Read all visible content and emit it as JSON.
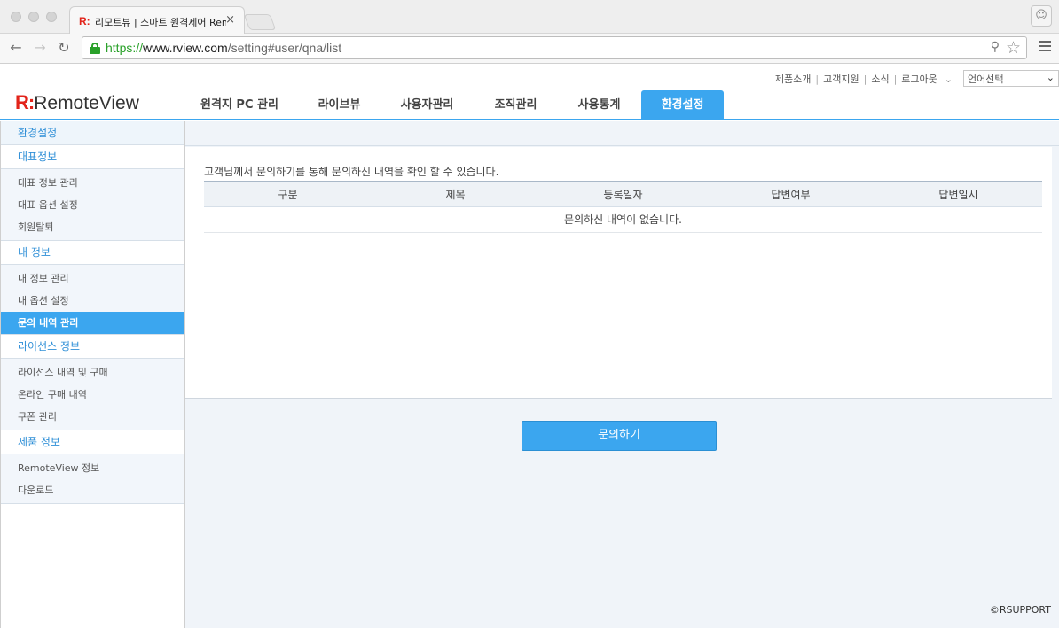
{
  "browser": {
    "tab_title": "리모트뷰 | 스마트 원격제어 RemoteView",
    "tab_favicon": "R:",
    "tab_close": "×",
    "url_scheme": "https://",
    "url_host": "www.rview.com",
    "url_path": "/setting#user/qna/list",
    "icons": {
      "back": "back-arrow-icon",
      "forward": "forward-arrow-icon",
      "reload": "reload-icon",
      "lock": "lock-icon",
      "key": "key-icon",
      "bookmark": "star-icon",
      "menu": "hamburger-menu-icon",
      "profile": "person-icon"
    }
  },
  "header": {
    "logo_mark": "R:",
    "logo_text": "RemoteView",
    "util_links": [
      "제품소개",
      "고객지원",
      "소식",
      "로그아웃"
    ],
    "language_select": "언어선택",
    "nav": [
      {
        "label": "원격지 PC 관리",
        "active": false
      },
      {
        "label": "라이브뷰",
        "active": false
      },
      {
        "label": "사용자관리",
        "active": false
      },
      {
        "label": "조직관리",
        "active": false
      },
      {
        "label": "사용통계",
        "active": false
      },
      {
        "label": "환경설정",
        "active": true
      }
    ],
    "accent_color": "#3ba6ef"
  },
  "sidebar": {
    "title": "환경설정",
    "sections": [
      {
        "heading": "대표정보",
        "items": [
          "대표 정보 관리",
          "대표 옵션 설정",
          "회원탈퇴"
        ]
      },
      {
        "heading": "내 정보",
        "items": [
          "내 정보 관리",
          "내 옵션 설정",
          "문의 내역 관리"
        ]
      },
      {
        "heading": "라이선스 정보",
        "items": [
          "라이선스 내역 및 구매",
          "온라인 구매 내역",
          "쿠폰 관리"
        ]
      },
      {
        "heading": "제품 정보",
        "items": [
          "RemoteView 정보",
          "다운로드"
        ]
      }
    ],
    "active_item": "문의 내역 관리"
  },
  "main": {
    "intro": "고객님께서 문의하기를 통해 문의하신 내역을 확인 할 수 있습니다.",
    "table": {
      "columns": [
        "구분",
        "제목",
        "등록일자",
        "답변여부",
        "답변일시"
      ],
      "empty_message": "문의하신 내역이 없습니다."
    },
    "ask_button": "문의하기"
  },
  "footer": {
    "copyright": "©RSUPPORT"
  }
}
